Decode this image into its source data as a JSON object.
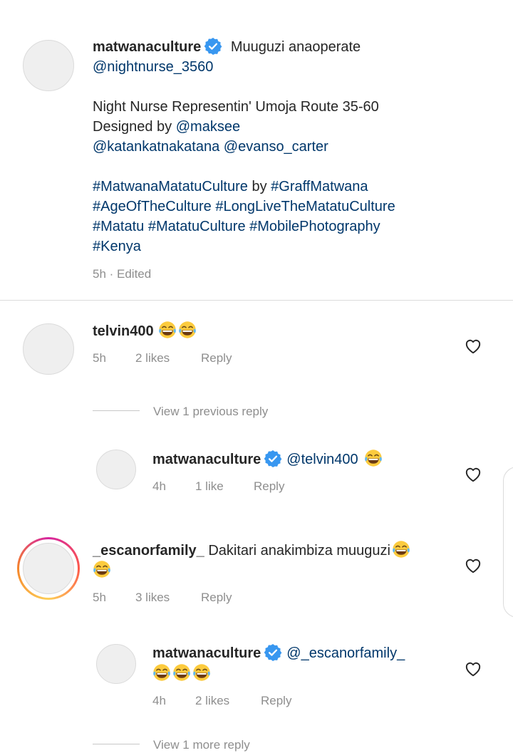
{
  "caption": {
    "username": "matwanaculture",
    "text1": " Muuguzi anaoperate",
    "mention1": "@nightnurse_3560",
    "text2": "Night Nurse Representin' Umoja Route 35-60",
    "text3": "Designed by ",
    "mention2": "@maksee",
    "mention3": "@katankatnakatana",
    "mention4": "@evanso_carter",
    "tag1": "#MatwanaMatatuCulture",
    "by": " by ",
    "tag2": "#GraffMatwana",
    "tag3": "#AgeOfTheCulture",
    "tag4": "#LongLiveTheMatatuCulture",
    "tag5": "#Matatu",
    "tag6": "#MatatuCulture",
    "tag7": "#MobilePhotography",
    "tag8": "#Kenya",
    "meta": "5h · Edited"
  },
  "comments": [
    {
      "username": "telvin400",
      "time": "5h",
      "likes": "2 likes",
      "reply": "Reply"
    },
    {
      "username": "matwanaculture",
      "mention": "@telvin400",
      "time": "4h",
      "likes": "1 like",
      "reply": "Reply"
    },
    {
      "username": "_escanorfamily_",
      "text": " Dakitari anakimbiza muuguzi",
      "time": "5h",
      "likes": "3 likes",
      "reply": "Reply"
    },
    {
      "username": "matwanaculture",
      "mention": "@_escanorfamily_",
      "time": "4h",
      "likes": "2 likes",
      "reply": "Reply"
    }
  ],
  "view_previous": "View 1 previous reply",
  "view_more": "View 1 more reply",
  "colors": {
    "link": "#00376b",
    "verified": "#3897f0",
    "meta": "#8e8e8e"
  },
  "icons": [
    "verified-badge-icon",
    "heart-icon",
    "laughing-emoji-icon"
  ]
}
